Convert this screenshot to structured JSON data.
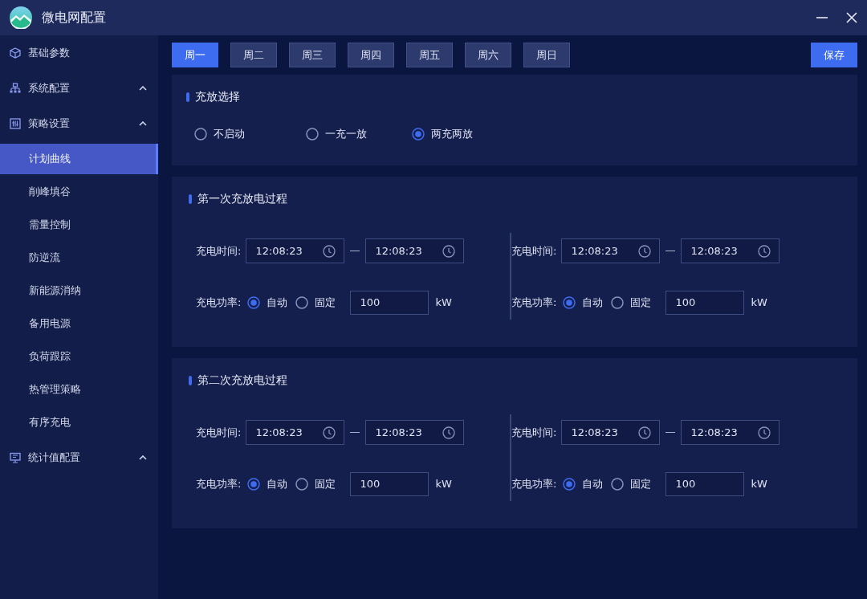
{
  "window": {
    "title": "微电网配置"
  },
  "sidebar": {
    "items": [
      {
        "label": "基础参数"
      },
      {
        "label": "系统配置",
        "expanded": true
      },
      {
        "label": "策略设置",
        "expanded": true,
        "children": [
          {
            "label": "计划曲线",
            "selected": true
          },
          {
            "label": "削峰填谷",
            "selected": false
          },
          {
            "label": "需量控制",
            "selected": false
          },
          {
            "label": "防逆流",
            "selected": false
          },
          {
            "label": "新能源消纳",
            "selected": false
          },
          {
            "label": "备用电源",
            "selected": false
          },
          {
            "label": "负荷跟踪",
            "selected": false
          },
          {
            "label": "热管理策略",
            "selected": false
          },
          {
            "label": "有序充电",
            "selected": false
          }
        ]
      },
      {
        "label": "统计值配置",
        "expanded": true
      }
    ]
  },
  "day_tabs": [
    {
      "label": "周一",
      "selected": true
    },
    {
      "label": "周二",
      "selected": false
    },
    {
      "label": "周三",
      "selected": false
    },
    {
      "label": "周四",
      "selected": false
    },
    {
      "label": "周五",
      "selected": false
    },
    {
      "label": "周六",
      "selected": false
    },
    {
      "label": "周日",
      "selected": false
    }
  ],
  "save_button": "保存",
  "mode_panel": {
    "title": "充放选择",
    "options": [
      {
        "label": "不启动",
        "selected": false
      },
      {
        "label": "一充一放",
        "selected": false
      },
      {
        "label": "两充两放",
        "selected": true
      }
    ]
  },
  "process_panels": [
    {
      "title": "第一次充放电过程",
      "groups": [
        {
          "time_label": "充电时间:",
          "start": "12:08:23",
          "end": "12:08:23",
          "power_label": "充电功率:",
          "power_options": [
            {
              "label": "自动",
              "selected": true
            },
            {
              "label": "固定",
              "selected": false
            }
          ],
          "power_value": "100",
          "unit": "kW"
        },
        {
          "time_label": "充电时间:",
          "start": "12:08:23",
          "end": "12:08:23",
          "power_label": "充电功率:",
          "power_options": [
            {
              "label": "自动",
              "selected": true
            },
            {
              "label": "固定",
              "selected": false
            }
          ],
          "power_value": "100",
          "unit": "kW"
        }
      ]
    },
    {
      "title": "第二次充放电过程",
      "groups": [
        {
          "time_label": "充电时间:",
          "start": "12:08:23",
          "end": "12:08:23",
          "power_label": "充电功率:",
          "power_options": [
            {
              "label": "自动",
              "selected": true
            },
            {
              "label": "固定",
              "selected": false
            }
          ],
          "power_value": "100",
          "unit": "kW"
        },
        {
          "time_label": "充电时间:",
          "start": "12:08:23",
          "end": "12:08:23",
          "power_label": "充电功率:",
          "power_options": [
            {
              "label": "自动",
              "selected": true
            },
            {
              "label": "固定",
              "selected": false
            }
          ],
          "power_value": "100",
          "unit": "kW"
        }
      ]
    }
  ]
}
